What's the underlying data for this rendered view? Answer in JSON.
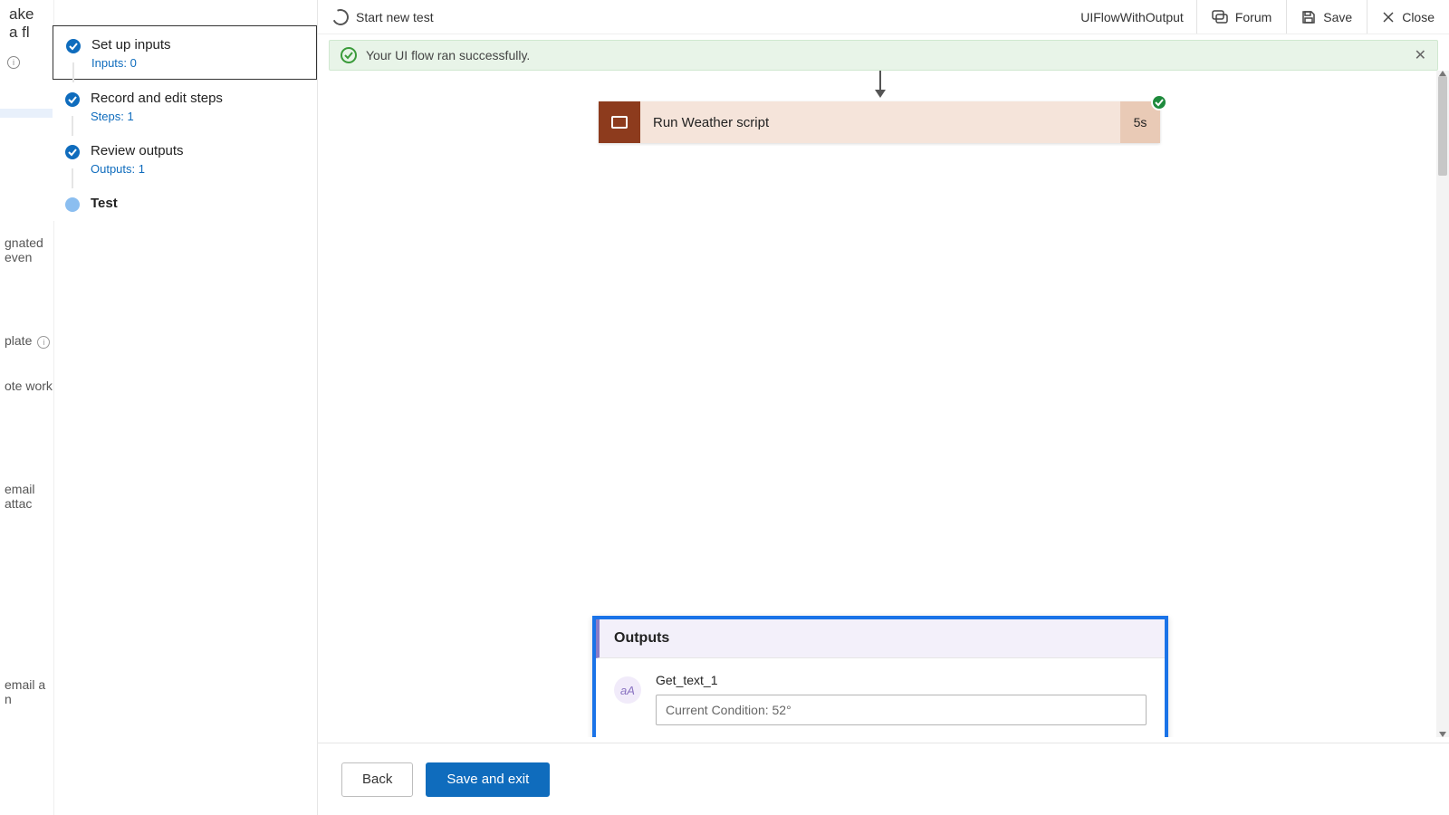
{
  "far_left": {
    "title_fragment": "ake a fl",
    "fragments": [
      "gnated even",
      "plate",
      "ote work",
      "email attac",
      "email a n"
    ]
  },
  "steps_panel": {
    "items": [
      {
        "title": "Set up inputs",
        "sub": "Inputs: 0"
      },
      {
        "title": "Record and edit steps",
        "sub": "Steps: 1"
      },
      {
        "title": "Review outputs",
        "sub": "Outputs: 1"
      },
      {
        "title": "Test"
      }
    ]
  },
  "header": {
    "start_new_test": "Start new test",
    "flow_name": "UIFlowWithOutput",
    "forum": "Forum",
    "save": "Save",
    "close": "Close"
  },
  "banner": {
    "text": "Your UI flow ran successfully."
  },
  "run_step": {
    "label": "Run Weather script",
    "duration": "5s"
  },
  "outputs": {
    "title": "Outputs",
    "rows": [
      {
        "name": "Get_text_1",
        "value": "Current Condition: 52°",
        "icon_text": "aA"
      }
    ]
  },
  "footer": {
    "back": "Back",
    "save_exit": "Save and exit"
  }
}
